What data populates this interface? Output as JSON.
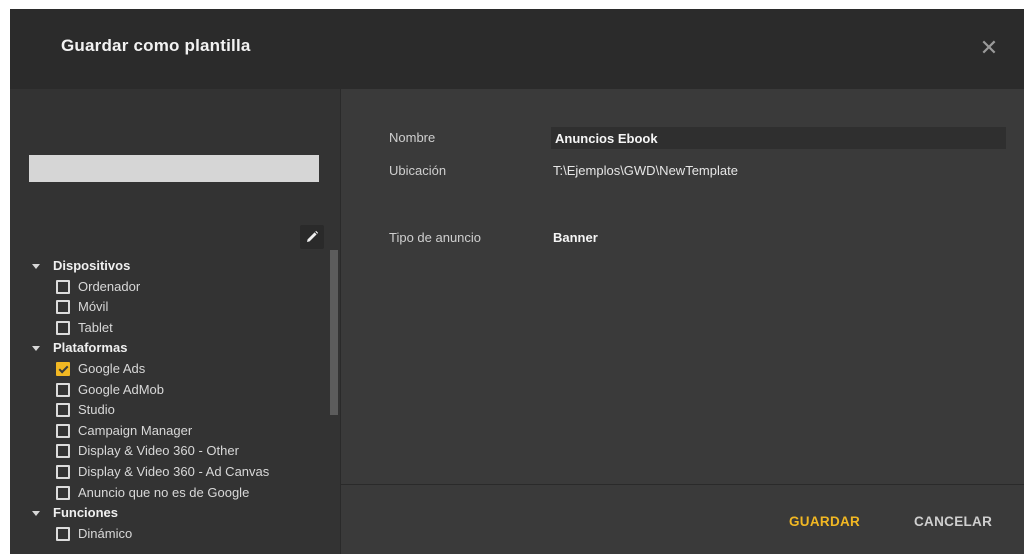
{
  "dialog": {
    "title": "Guardar como plantilla",
    "close_icon": "close-icon"
  },
  "sidebar": {
    "name_input_value": "",
    "edit_icon": "pencil-icon",
    "categories": [
      {
        "label": "Dispositivos",
        "expanded": true,
        "items": [
          {
            "label": "Ordenador",
            "checked": false
          },
          {
            "label": "Móvil",
            "checked": false
          },
          {
            "label": "Tablet",
            "checked": false
          }
        ]
      },
      {
        "label": "Plataformas",
        "expanded": true,
        "items": [
          {
            "label": "Google Ads",
            "checked": true
          },
          {
            "label": "Google AdMob",
            "checked": false
          },
          {
            "label": "Studio",
            "checked": false
          },
          {
            "label": "Campaign Manager",
            "checked": false
          },
          {
            "label": "Display & Video 360 - Other",
            "checked": false
          },
          {
            "label": "Display & Video 360 - Ad Canvas",
            "checked": false
          },
          {
            "label": "Anuncio que no es de Google",
            "checked": false
          }
        ]
      },
      {
        "label": "Funciones",
        "expanded": true,
        "items": [
          {
            "label": "Dinámico",
            "checked": false
          }
        ]
      }
    ]
  },
  "details": {
    "name_label": "Nombre",
    "name_value": "Anuncios Ebook",
    "location_label": "Ubicación",
    "location_value": "T:\\Ejemplos\\GWD\\NewTemplate",
    "ad_type_label": "Tipo de anuncio",
    "ad_type_value": "Banner"
  },
  "footer": {
    "save_label": "GUARDAR",
    "cancel_label": "CANCELAR"
  },
  "colors": {
    "accent": "#f2b823",
    "header_bg": "#2b2b2b",
    "panel_bg": "#3a3a3a"
  }
}
